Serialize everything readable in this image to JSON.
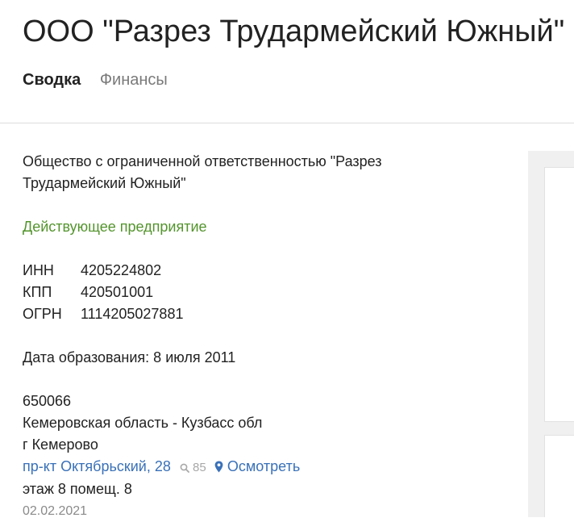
{
  "header": {
    "title": "ООО \"Разрез Трудармейский Южный\"",
    "tabs": [
      {
        "label": "Сводка",
        "active": true
      },
      {
        "label": "Финансы",
        "active": false
      }
    ]
  },
  "company": {
    "full_name": "Общество с ограниченной ответственностью \"Разрез Трудармейский Южный\"",
    "status": "Действующее предприятие",
    "codes": [
      {
        "label": "ИНН",
        "value": "4205224802"
      },
      {
        "label": "КПП",
        "value": "420501001"
      },
      {
        "label": "ОГРН",
        "value": "1114205027881"
      }
    ],
    "registration": "Дата образования: 8 июля 2011",
    "address": {
      "postal_code": "650066",
      "region": "Кемеровская область - Кузбасс обл",
      "city": "г Кемерово",
      "street": "пр-кт Октябрьский, 28",
      "views": "85",
      "view_link": "Осмотреть",
      "detail": "этаж 8 помещ. 8"
    },
    "date": "02.02.2021"
  },
  "colors": {
    "status": "#53942d",
    "link": "#3a71b8",
    "muted": "#a8a8a8",
    "side_panel": "#f0f0f0"
  },
  "icons": {
    "views": "search-icon",
    "map": "map-pin-icon"
  }
}
